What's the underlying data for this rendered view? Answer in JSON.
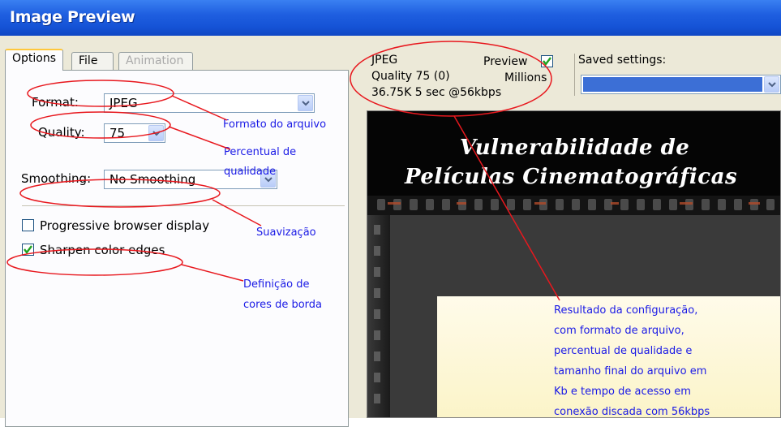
{
  "window": {
    "title": "Image Preview"
  },
  "tabs": [
    {
      "label": "Options"
    },
    {
      "label": "File"
    },
    {
      "label": "Animation"
    }
  ],
  "options": {
    "format_label": "Format:",
    "format_value": "JPEG",
    "quality_label": "Quality:",
    "quality_value": "75",
    "smoothing_label": "Smoothing:",
    "smoothing_value": "No Smoothing",
    "progressive_label": "Progressive browser display",
    "progressive_checked": false,
    "sharpen_label": "Sharpen color edges",
    "sharpen_checked": true
  },
  "preview_info": {
    "format": "JPEG",
    "quality": "Quality 75 (0)",
    "size_time": "36.75K  5 sec @56kbps",
    "preview_label": "Preview",
    "preview_checked": true,
    "colors": "Millions"
  },
  "saved_settings": {
    "label": "Saved settings:",
    "value": ""
  },
  "preview_image": {
    "line1": "Vulnerabilidade de",
    "line2": "Películas Cinematográficas"
  },
  "annotations": {
    "format": "Formato do arquivo",
    "quality_1": "Percentual de",
    "quality_2": "qualidade",
    "smoothing": "Suavização",
    "sharpen_1": "Definição de",
    "sharpen_2": "cores de borda",
    "result": [
      "Resultado da configuração,",
      "com formato de arquivo,",
      "percentual de qualidade e",
      "tamanho final do arquivo em",
      "Kb e tempo de acesso em",
      "conexão discada com 56kbps"
    ]
  },
  "colors": {
    "titlebar": "#1f5fe0",
    "annotation_text": "#1a1ae6",
    "annotation_line": "#e8181e",
    "dialog_bg": "#ece9d8",
    "checkmark": "#21a121",
    "saved_fill": "#3c6fd6"
  }
}
